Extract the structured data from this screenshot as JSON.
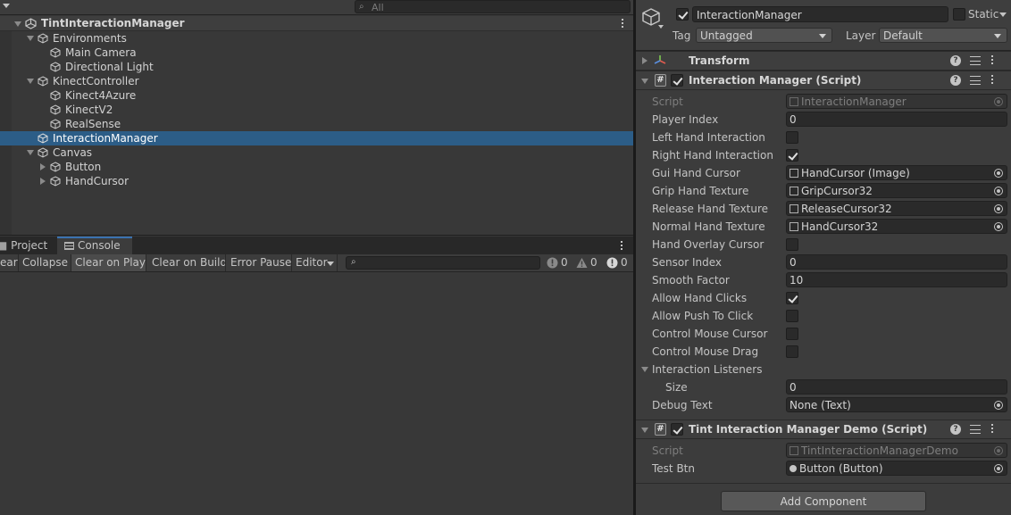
{
  "hierarchy": {
    "search_placeholder": "All",
    "scene_name": "TintInteractionManager",
    "items": [
      {
        "label": "Environments"
      },
      {
        "label": "Main Camera"
      },
      {
        "label": "Directional Light"
      },
      {
        "label": "KinectController"
      },
      {
        "label": "Kinect4Azure"
      },
      {
        "label": "KinectV2"
      },
      {
        "label": "RealSense"
      },
      {
        "label": "InteractionManager"
      },
      {
        "label": "Canvas"
      },
      {
        "label": "Button"
      },
      {
        "label": "HandCursor"
      }
    ]
  },
  "bottom_panel": {
    "tabs": {
      "project": "Project",
      "console": "Console"
    },
    "buttons": {
      "clear": "ear",
      "collapse": "Collapse",
      "clear_on_play": "Clear on Play",
      "clear_on_build": "Clear on Build",
      "error_pause": "Error Pause",
      "editor": "Editor"
    },
    "counts": {
      "messages": "0",
      "warnings": "0",
      "errors": "0"
    }
  },
  "inspector": {
    "object_name": "InteractionManager",
    "static_label": "Static",
    "tag_label": "Tag",
    "tag_value": "Untagged",
    "layer_label": "Layer",
    "layer_value": "Default",
    "transform_title": "Transform",
    "interaction_manager": {
      "title": "Interaction Manager (Script)",
      "script_label": "Script",
      "script_value": "InteractionManager",
      "player_index_label": "Player Index",
      "player_index": "0",
      "left_hand_label": "Left Hand Interaction",
      "right_hand_label": "Right Hand Interaction",
      "gui_hand_cursor_label": "Gui Hand Cursor",
      "gui_hand_cursor": "HandCursor (Image)",
      "grip_hand_label": "Grip Hand Texture",
      "grip_hand": "GripCursor32",
      "release_hand_label": "Release Hand Texture",
      "release_hand": "ReleaseCursor32",
      "normal_hand_label": "Normal Hand Texture",
      "normal_hand": "HandCursor32",
      "hand_overlay_label": "Hand Overlay Cursor",
      "sensor_index_label": "Sensor Index",
      "sensor_index": "0",
      "smooth_factor_label": "Smooth Factor",
      "smooth_factor": "10",
      "allow_hand_clicks_label": "Allow Hand Clicks",
      "allow_push_label": "Allow Push To Click",
      "control_mouse_cursor_label": "Control Mouse Cursor",
      "control_mouse_drag_label": "Control Mouse Drag",
      "listeners_label": "Interaction Listeners",
      "size_label": "Size",
      "size": "0",
      "debug_text_label": "Debug Text",
      "debug_text": "None (Text)"
    },
    "demo": {
      "title": "Tint Interaction Manager Demo (Script)",
      "script_label": "Script",
      "script_value": "TintInteractionManagerDemo",
      "test_btn_label": "Test Btn",
      "test_btn": "Button (Button)"
    },
    "add_component": "Add Component"
  }
}
